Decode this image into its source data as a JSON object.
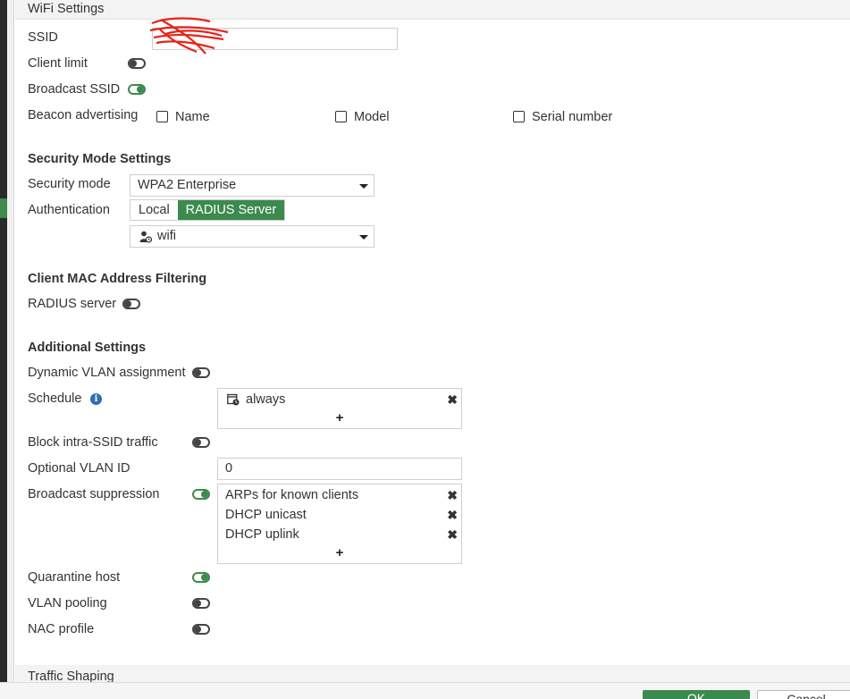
{
  "wifi_settings": {
    "header": "WiFi Settings",
    "ssid_label": "SSID",
    "ssid_value": "",
    "client_limit_label": "Client limit",
    "broadcast_ssid_label": "Broadcast SSID",
    "beacon_label": "Beacon advertising",
    "beacon_options": [
      "Name",
      "Model",
      "Serial number"
    ]
  },
  "security": {
    "heading": "Security Mode Settings",
    "mode_label": "Security mode",
    "mode_value": "WPA2 Enterprise",
    "auth_label": "Authentication",
    "auth_options": [
      "Local",
      "RADIUS Server"
    ],
    "auth_selected": "RADIUS Server",
    "radius_value": "wifi"
  },
  "mac_filtering": {
    "heading": "Client MAC Address Filtering",
    "radius_server_label": "RADIUS server"
  },
  "additional": {
    "heading": "Additional Settings",
    "dynamic_vlan_label": "Dynamic VLAN assignment",
    "schedule_label": "Schedule",
    "schedule_items": [
      "always"
    ],
    "plus": "+",
    "block_intra_label": "Block intra-SSID traffic",
    "optional_vlan_label": "Optional VLAN ID",
    "optional_vlan_value": "0",
    "broadcast_suppression_label": "Broadcast suppression",
    "suppression_items": [
      "ARPs for known clients",
      "DHCP unicast",
      "DHCP uplink"
    ],
    "quarantine_label": "Quarantine host",
    "vlan_pooling_label": "VLAN pooling",
    "nac_profile_label": "NAC profile"
  },
  "traffic_shaping": {
    "header": "Traffic Shaping"
  },
  "footer": {
    "ok_label": "OK",
    "cancel_label": "Cancel"
  },
  "colors": {
    "accent": "#3c8a4e",
    "info": "#2d6db3"
  },
  "icons": {
    "x": "✖",
    "info": "i"
  }
}
